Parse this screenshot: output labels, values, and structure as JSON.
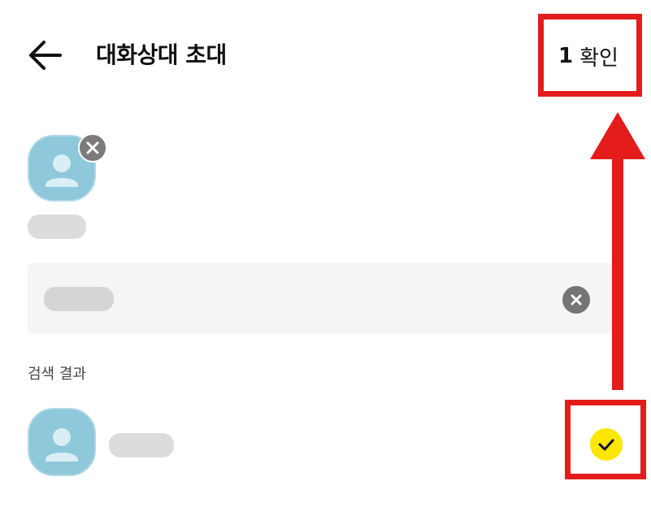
{
  "header": {
    "back_icon": "arrow-left-icon",
    "title": "대화상대 초대",
    "confirm_count": "1",
    "confirm_label": "확인"
  },
  "selected": {
    "avatar_icon": "person-icon",
    "remove_icon": "close-icon"
  },
  "search": {
    "clear_icon": "clear-icon"
  },
  "results": {
    "section_label": "검색 결과",
    "check_icon": "check-icon"
  },
  "colors": {
    "avatar_bg": "#8fc8da",
    "check_bg": "#fde600",
    "annotation": "#e41c1c"
  }
}
